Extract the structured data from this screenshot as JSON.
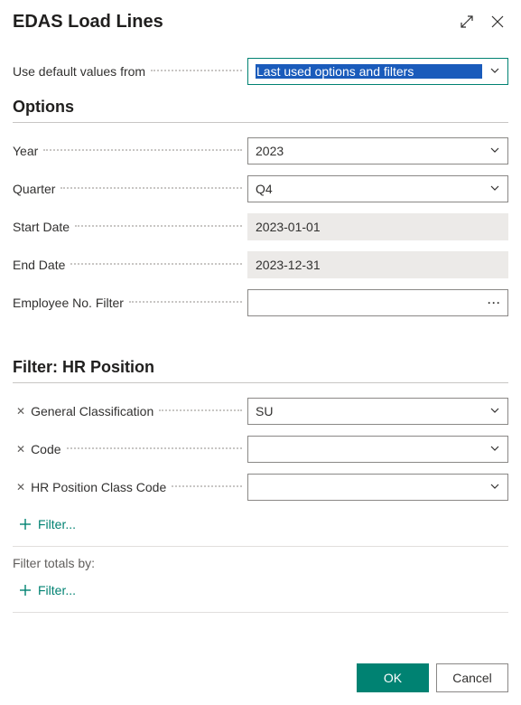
{
  "title": "EDAS Load Lines",
  "defaults": {
    "label": "Use default values from",
    "value": "Last used options and filters"
  },
  "sections": {
    "options": "Options",
    "filter": "Filter: HR Position",
    "totals": "Filter totals by:"
  },
  "options": {
    "year": {
      "label": "Year",
      "value": "2023"
    },
    "quarter": {
      "label": "Quarter",
      "value": "Q4"
    },
    "start_date": {
      "label": "Start Date",
      "value": "2023-01-01"
    },
    "end_date": {
      "label": "End Date",
      "value": "2023-12-31"
    },
    "employee_filter": {
      "label": "Employee No. Filter",
      "value": ""
    }
  },
  "filter": {
    "gen_class": {
      "label": "General Classification",
      "value": "SU"
    },
    "code": {
      "label": "Code",
      "value": ""
    },
    "pos_class": {
      "label": "HR Position Class Code",
      "value": ""
    }
  },
  "add_filter_label": "Filter...",
  "buttons": {
    "ok": "OK",
    "cancel": "Cancel"
  }
}
